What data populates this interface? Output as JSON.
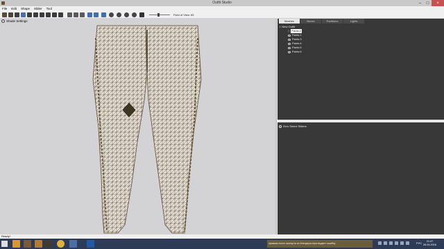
{
  "window": {
    "title": "Outfit Studio"
  },
  "menu": [
    "File",
    "Edit",
    "Shape",
    "Slider",
    "Tool"
  ],
  "toolbar": {
    "fov_label": "Field of View: 65"
  },
  "viewport": {
    "shade_label": "Shade Settings"
  },
  "right_panel": {
    "tabs": [
      "Meshes",
      "Bones",
      "Partitions",
      "Lights"
    ],
    "active_tab": "Meshes",
    "tree": {
      "root": "New Outfit",
      "children": [
        "Pants:2",
        "Pants:1",
        "Pants:3",
        "Pants:4",
        "Pants:5",
        "Pants:6"
      ]
    },
    "slider_header": "Zero Select Sliders"
  },
  "status": {
    "text": "Ready!"
  },
  "taskbar": {
    "notice": "прямым после экспорта из блендера игра выдает ошибку",
    "lang": "РУС",
    "time": "21:47",
    "date": "26.04.2016"
  },
  "colors": {
    "panel_bg": "#383838",
    "viewport_bg": "#d3d3d5",
    "taskbar_bg": "#2d3b57",
    "close_btn": "#c75050"
  }
}
